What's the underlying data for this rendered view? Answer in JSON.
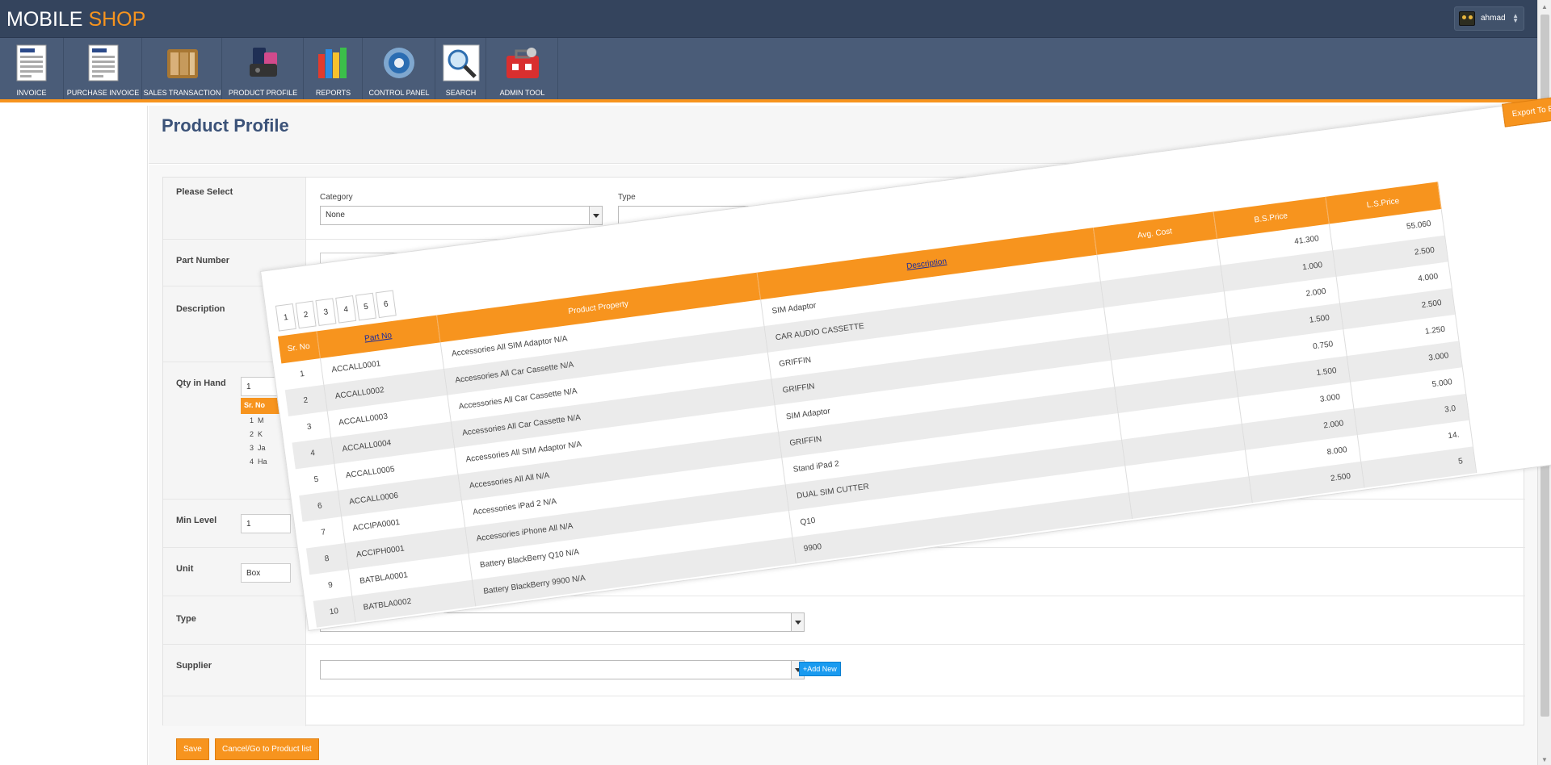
{
  "brand": {
    "part1": "MOBILE",
    "part2": "SHOP"
  },
  "user": {
    "name": "ahmad"
  },
  "toolbar": [
    {
      "label": "INVOICE",
      "icon": "invoice-icon"
    },
    {
      "label": "PURCHASE INVOICE",
      "icon": "purchase-invoice-icon"
    },
    {
      "label": "SALES TRANSACTION",
      "icon": "sales-transaction-icon"
    },
    {
      "label": "PRODUCT PROFILE",
      "icon": "product-profile-icon"
    },
    {
      "label": "REPORTS",
      "icon": "reports-icon"
    },
    {
      "label": "CONTROL PANEL",
      "icon": "control-panel-icon"
    },
    {
      "label": "SEARCH",
      "icon": "search-icon"
    },
    {
      "label": "ADMIN TOOL",
      "icon": "admin-tool-icon"
    }
  ],
  "page": {
    "title": "Product Profile"
  },
  "form": {
    "please_select": "Please Select",
    "category_label": "Category",
    "category_value": "None",
    "type_label": "Type",
    "part_number": "Part Number",
    "description": "Description",
    "qty_in_hand": "Qty in Hand",
    "qty_value": "1",
    "min_level": "Min Level",
    "min_value": "1",
    "unit": "Unit",
    "unit_value": "Box",
    "type": "Type",
    "supplier": "Supplier",
    "add_new": "+Add New",
    "save": "Save",
    "cancel": "Cancel/Go to Product list"
  },
  "mini_table": {
    "header": "Sr. No",
    "rows": [
      [
        "1",
        "M"
      ],
      [
        "2",
        "K"
      ],
      [
        "3",
        "Ja"
      ],
      [
        "4",
        "Ha"
      ]
    ]
  },
  "dialog": {
    "export": "Export To Excel",
    "pages": [
      "1",
      "2",
      "3",
      "4",
      "5",
      "6"
    ],
    "columns": [
      "Sr. No",
      "Part No",
      "Product Property",
      "Description",
      "Avg. Cost",
      "B.S.Price",
      "L.S.Price"
    ],
    "rows": [
      [
        "1",
        "ACCALL0001",
        "Accessories All SIM Adaptor N/A",
        "SIM Adaptor",
        "",
        "41.300",
        "55.060"
      ],
      [
        "2",
        "ACCALL0002",
        "Accessories All Car Cassette N/A",
        "CAR AUDIO CASSETTE",
        "",
        "1.000",
        "2.500"
      ],
      [
        "3",
        "ACCALL0003",
        "Accessories All Car Cassette N/A",
        "GRIFFIN",
        "",
        "2.000",
        "4.000"
      ],
      [
        "4",
        "ACCALL0004",
        "Accessories All Car Cassette N/A",
        "GRIFFIN",
        "",
        "1.500",
        "2.500"
      ],
      [
        "5",
        "ACCALL0005",
        "Accessories All SIM Adaptor N/A",
        "SIM Adaptor",
        "",
        "0.750",
        "1.250"
      ],
      [
        "6",
        "ACCALL0006",
        "Accessories All All N/A",
        "GRIFFIN",
        "",
        "1.500",
        "3.000"
      ],
      [
        "7",
        "ACCIPA0001",
        "Accessories iPad 2 N/A",
        "Stand iPad 2",
        "",
        "3.000",
        "5.000"
      ],
      [
        "8",
        "ACCIPH0001",
        "Accessories iPhone All N/A",
        "DUAL SIM CUTTER",
        "",
        "2.000",
        "3.0"
      ],
      [
        "9",
        "BATBLA0001",
        "Battery BlackBerry Q10 N/A",
        "Q10",
        "",
        "8.000",
        "14."
      ],
      [
        "10",
        "BATBLA0002",
        "Battery BlackBerry 9900 N/A",
        "9900",
        "",
        "2.500",
        "5"
      ]
    ]
  },
  "colors": {
    "orange": "#f7941e",
    "navy": "#34445d",
    "toolbar": "#4a5c78",
    "title": "#3b5278"
  }
}
